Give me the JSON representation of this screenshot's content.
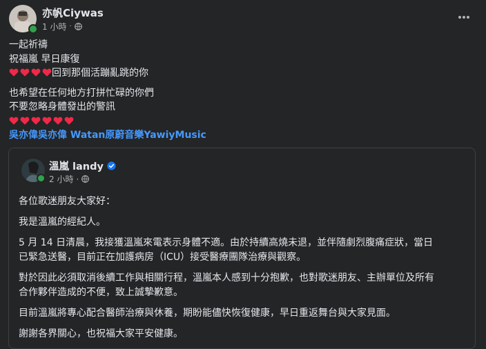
{
  "post": {
    "author": "亦帆Ciywas",
    "time": "1 小時",
    "separator": "·",
    "privacy_icon": "globe-icon",
    "more_icon": "more-options-icon",
    "lines": [
      "一起祈禱",
      "祝福嵐 早日康復"
    ],
    "heart_line_text": "回到那個活蹦亂跳的你",
    "lines2": [
      "也希望在任何地方打拼忙碌的你們",
      "不要忽略身體發出的警訊"
    ],
    "tags": "吳亦偉吳亦偉 Watan原蔚音樂YawiyMusic"
  },
  "shared_post": {
    "author": "溫嵐 landy",
    "verified_icon": "verified-badge-icon",
    "time": "2 小時",
    "separator": "·",
    "privacy_icon": "globe-icon",
    "paragraphs": [
      [
        "各位歌迷朋友大家好："
      ],
      [
        "我是溫嵐的經紀人。"
      ],
      [
        "5 月 14 日清晨，我接獲溫嵐來電表示身體不適。由於持續高燒未退，並伴隨劇烈腹痛症狀，當日",
        "已緊急送醫，目前正在加護病房（ICU）接受醫療團隊治療與觀察。"
      ],
      [
        "對於因此必須取消後續工作與相關行程，溫嵐本人感到十分抱歉，也對歌迷朋友、主辦單位及所有",
        "合作夥伴造成的不便，致上誠摯歉意。"
      ],
      [
        "目前溫嵐將專心配合醫師治療與休養，期盼能儘快恢復健康，早日重返舞台與大家見面。"
      ],
      [
        "謝謝各界關心，也祝福大家平安健康。"
      ]
    ]
  },
  "colors": {
    "background": "#242526",
    "text": "#e4e6eb",
    "secondary_text": "#b0b3b8",
    "link": "#4599ff",
    "heart": "#f02849",
    "online": "#31a24c",
    "verified": "#1877f2"
  }
}
